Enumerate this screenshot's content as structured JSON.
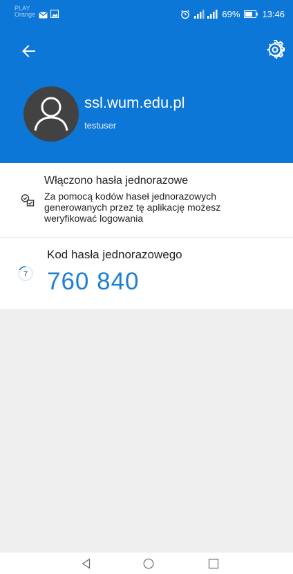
{
  "status_bar": {
    "carrier_line1": "PLAY",
    "carrier_line2": "Orange",
    "battery_percent": "69%",
    "time": "13:46"
  },
  "header": {
    "account_name": "ssl.wum.edu.pl",
    "username": "testuser",
    "back_icon": "arrow-left-icon",
    "settings_icon": "gear-icon"
  },
  "otp_info": {
    "title": "Włączono hasła jednorazowe",
    "description": "Za pomocą kodów haseł jednorazowych generowanych przez tę aplikację możesz weryfikować logowania",
    "icon": "checklist-icon"
  },
  "otp_code": {
    "label": "Kod hasła jednorazowego",
    "value": "760 840",
    "seconds_remaining": "7",
    "icon": "countdown-timer-icon"
  },
  "colors": {
    "header_bg": "#0c77d6",
    "avatar_bg": "#424242",
    "code_color": "#1b7fd4",
    "page_bg": "#efefef"
  },
  "nav_bar": {
    "icons": [
      "nav-back-icon",
      "nav-home-icon",
      "nav-recents-icon"
    ]
  }
}
